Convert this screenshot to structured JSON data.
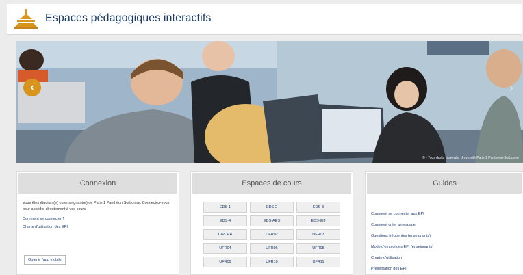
{
  "header": {
    "title": "Espaces pédagogiques interactifs"
  },
  "hero": {
    "credit": "© - Tous droits réservés, Université Paris 1 Panthéon-Sorbonne",
    "prev_glyph": "‹",
    "next_glyph": "›"
  },
  "connexion": {
    "title": "Connexion",
    "intro": "Vous êtes étudiant(e) ou enseignant(e) de Paris 1 Panthéon Sorbonne. Connectez-vous pour accéder directement à vos cours.",
    "links": [
      "Comment se connecter ?",
      "Charte d'utilisation des EPI"
    ],
    "app_button": "Obtenir l'app mobile"
  },
  "courses": {
    "title": "Espaces de cours",
    "items": [
      "EDS-1",
      "EDS-2",
      "EDS-3",
      "EDS-4",
      "EDS-AES",
      "EDS-IEJ",
      "CIPCEA",
      "UFR02",
      "UFR03",
      "UFR04",
      "UFR06",
      "UFR08",
      "UFR09",
      "UFR10",
      "UFR11"
    ]
  },
  "guides": {
    "title": "Guides",
    "items": [
      "Comment se connecter aux EPI",
      "Comment créer un espace",
      "Questions fréquentes (enseignants)",
      "Mode d'emploi des EPI (enseignants)",
      "Charte d'utilisation",
      "Présentation des EPI"
    ]
  },
  "colors": {
    "accent": "#d8951e",
    "link": "#1b3a6b",
    "panel_head": "#dedede"
  }
}
